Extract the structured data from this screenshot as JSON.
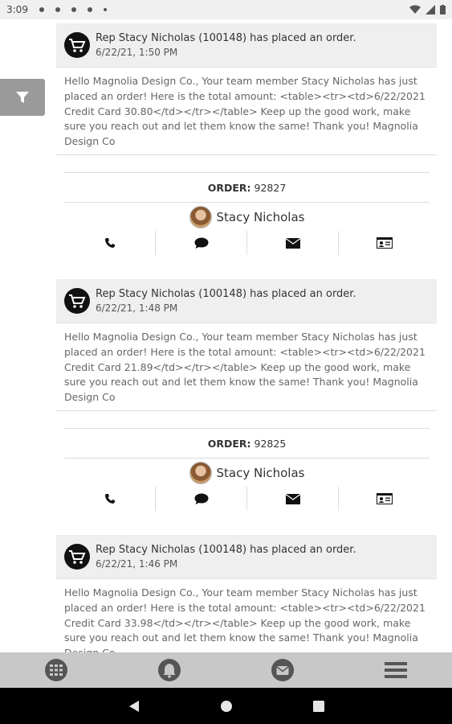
{
  "status_bar": {
    "time": "3:09"
  },
  "icons": {
    "filter": "filter-icon",
    "cart": "shopping-cart-icon",
    "phone": "phone-icon",
    "chat": "chat-bubble-icon",
    "mail": "envelope-icon",
    "contact": "contact-card-icon",
    "grid": "grid-icon",
    "bell": "bell-icon",
    "envelope_circle": "envelope-circle-icon",
    "menu": "hamburger-menu-icon"
  },
  "colors": {
    "header_bg": "#efefef",
    "nav_bg": "#c8c8c8",
    "filter_bg": "#9a9a9a"
  },
  "notifications": [
    {
      "title": "Rep Stacy Nicholas (100148) has placed an order.",
      "date": "6/22/21, 1:50 PM",
      "body": "Hello Magnolia Design Co., Your team member Stacy Nicholas has just placed an order! Here is the total amount: <table><tr><td>6/22/2021 Credit Card 30.80</td></tr></table> Keep up the good work, make sure you reach out and let them know the same! Thank you! Magnolia Design Co",
      "order_label": "ORDER:",
      "order_number": "92827",
      "rep_name": "Stacy Nicholas"
    },
    {
      "title": "Rep Stacy Nicholas (100148) has placed an order.",
      "date": "6/22/21, 1:48 PM",
      "body": "Hello Magnolia Design Co., Your team member Stacy Nicholas has just placed an order! Here is the total amount: <table><tr><td>6/22/2021 Credit Card 21.89</td></tr></table> Keep up the good work, make sure you reach out and let them know the same! Thank you! Magnolia Design Co",
      "order_label": "ORDER:",
      "order_number": "92825",
      "rep_name": "Stacy Nicholas"
    },
    {
      "title": "Rep Stacy Nicholas (100148) has placed an order.",
      "date": "6/22/21, 1:46 PM",
      "body": "Hello Magnolia Design Co., Your team member Stacy Nicholas has just placed an order! Here is the total amount: <table><tr><td>6/22/2021 Credit Card 33.98</td></tr></table> Keep up the good work, make sure you reach out and let them know the same! Thank you! Magnolia Design Co"
    }
  ]
}
